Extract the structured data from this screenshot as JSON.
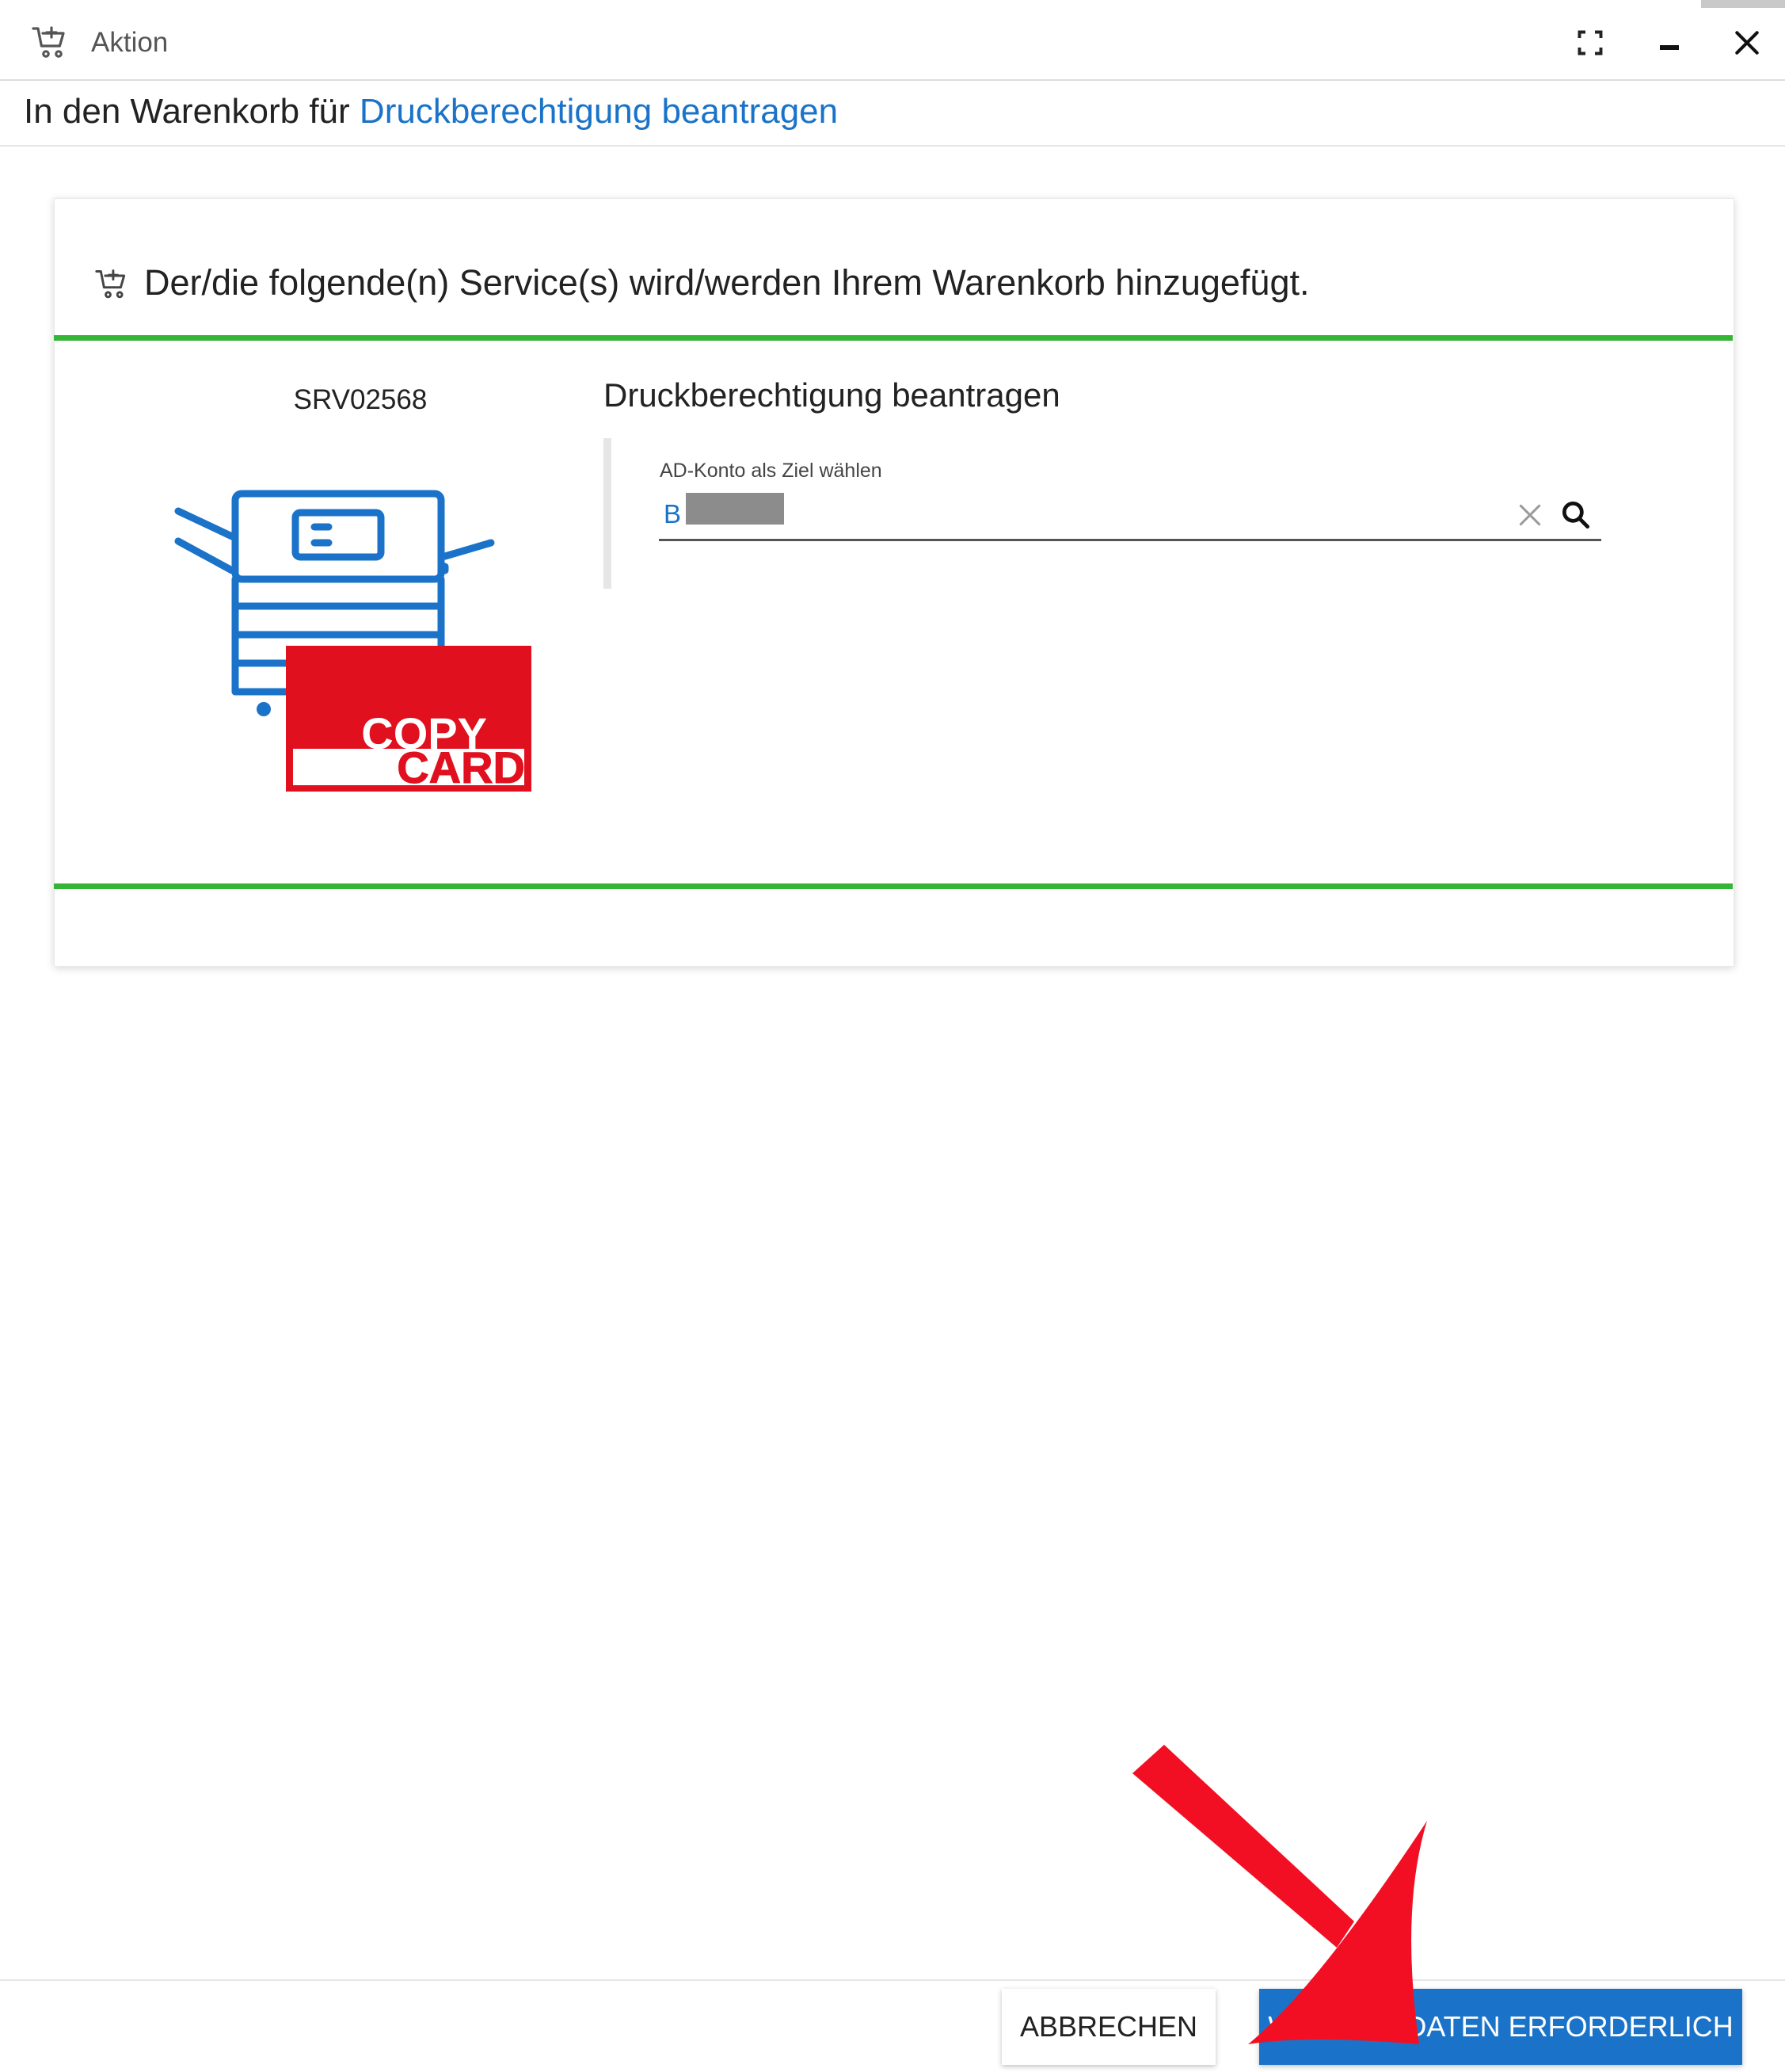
{
  "window": {
    "title": "Aktion",
    "controls": [
      "fullscreen-icon",
      "minimize-icon",
      "close-icon"
    ]
  },
  "subtitle": {
    "prefix": "In den Warenkorb für",
    "link": "Druckberechtigung beantragen"
  },
  "card": {
    "header": "Der/die folgende(n) Service(s) wird/werden Ihrem Warenkorb hinzugefügt.",
    "service_id": "SRV02568",
    "service_title": "Druckberechtigung beantragen",
    "illustration": {
      "line1": "COPY",
      "line2": "CARD"
    },
    "field": {
      "label": "AD-Konto als Ziel wählen",
      "value": "B"
    }
  },
  "footer": {
    "cancel_label": "ABBRECHEN",
    "submit_label": "WEITERE DATEN ERFORDERLICH"
  },
  "colors": {
    "accent": "#1a73c8",
    "divider_green": "#35b535",
    "card_red": "#e0101e",
    "annotation_arrow": "#f20f23"
  }
}
